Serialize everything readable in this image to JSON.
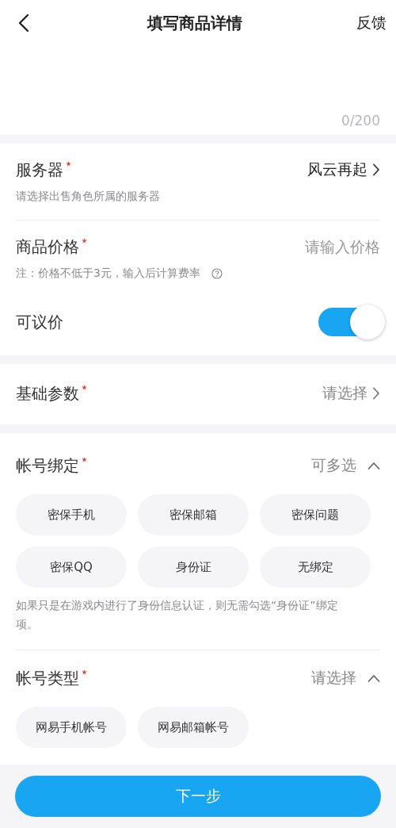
{
  "header": {
    "title": "填写商品详情",
    "action": "反馈"
  },
  "description": {
    "counter": "0/200"
  },
  "server": {
    "label": "服务器",
    "required": true,
    "value": "风云再起",
    "hint": "请选择出售角色所属的服务器"
  },
  "price": {
    "label": "商品价格",
    "required": true,
    "placeholder": "请输入价格",
    "note": "注：价格不低于3元，输入后计算费率"
  },
  "negotiable": {
    "label": "可议价",
    "on": true
  },
  "basic_params": {
    "label": "基础参数",
    "required": true,
    "placeholder": "请选择"
  },
  "account_binding": {
    "label": "帐号绑定",
    "required": true,
    "hint": "可多选",
    "expanded": true,
    "options": [
      {
        "label": "密保手机",
        "selected": false
      },
      {
        "label": "密保邮箱",
        "selected": false
      },
      {
        "label": "密保问题",
        "selected": false
      },
      {
        "label": "密保QQ",
        "selected": false
      },
      {
        "label": "身份证",
        "selected": false
      },
      {
        "label": "无绑定",
        "selected": false
      }
    ],
    "note": "如果只是在游戏内进行了身份信息认证，则无需勾选“身份证”绑定项。"
  },
  "account_type": {
    "label": "帐号类型",
    "required": true,
    "placeholder": "请选择",
    "expanded": true,
    "options": [
      {
        "label": "网易手机帐号",
        "selected": false
      },
      {
        "label": "网易邮箱帐号",
        "selected": false
      }
    ]
  },
  "next_button": "下一步"
}
